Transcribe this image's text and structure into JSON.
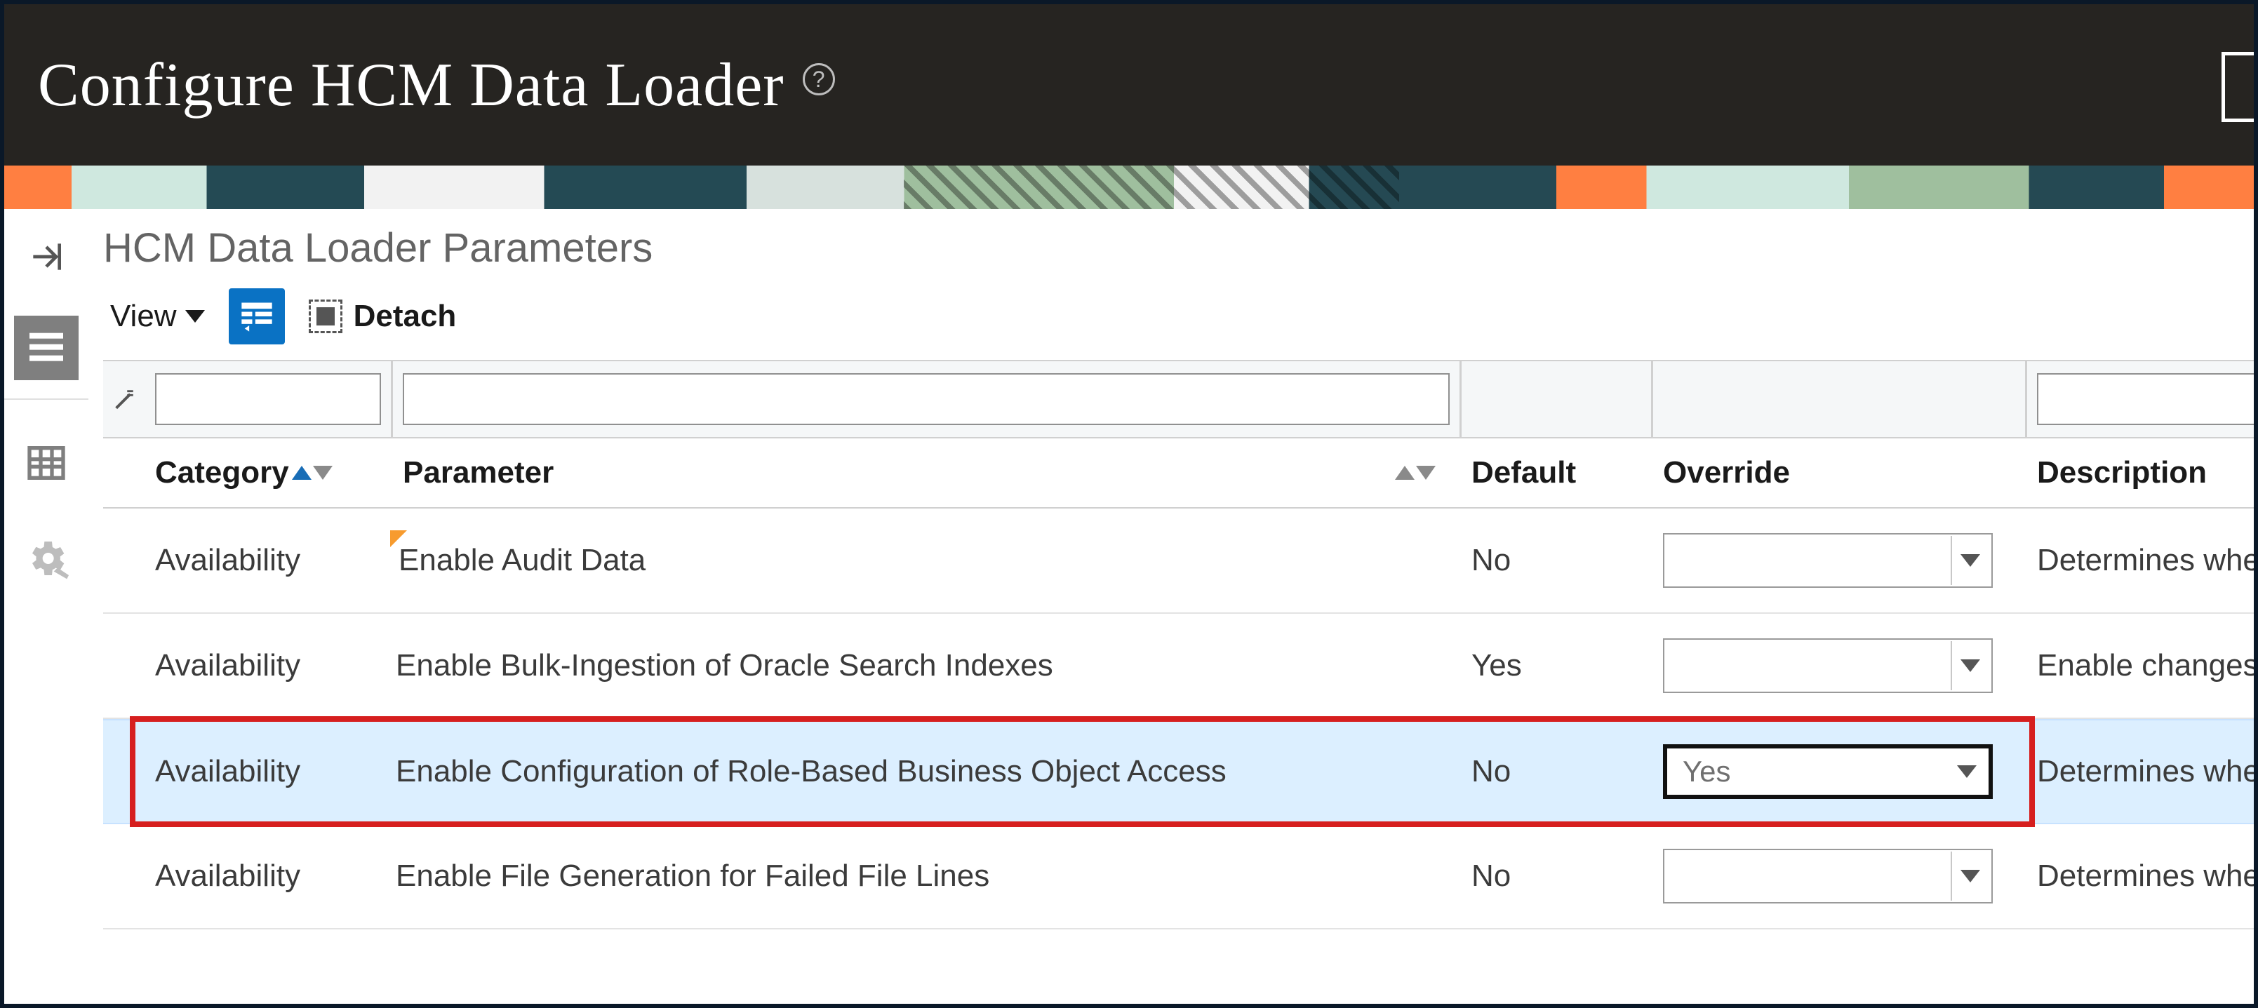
{
  "header": {
    "title": "Configure HCM Data Loader"
  },
  "section": {
    "title": "HCM Data Loader Parameters"
  },
  "toolbar": {
    "view": "View",
    "detach": "Detach"
  },
  "columns": {
    "category": "Category",
    "parameter": "Parameter",
    "default": "Default",
    "override": "Override",
    "description": "Description"
  },
  "rows": [
    {
      "category": "Availability",
      "parameter": "Enable Audit Data",
      "flag": true,
      "default": "No",
      "override": "",
      "description": "Determines wheth"
    },
    {
      "category": "Availability",
      "parameter": "Enable Bulk-Ingestion of Oracle Search Indexes",
      "flag": false,
      "default": "Yes",
      "override": "",
      "description": "Enable changes u"
    },
    {
      "category": "Availability",
      "parameter": "Enable Configuration of Role-Based Business Object Access",
      "flag": false,
      "default": "No",
      "override": "Yes",
      "description": "Determines wheth",
      "highlight": true
    },
    {
      "category": "Availability",
      "parameter": "Enable File Generation for Failed File Lines",
      "flag": false,
      "default": "No",
      "override": "",
      "description": "Determines wheth"
    }
  ]
}
